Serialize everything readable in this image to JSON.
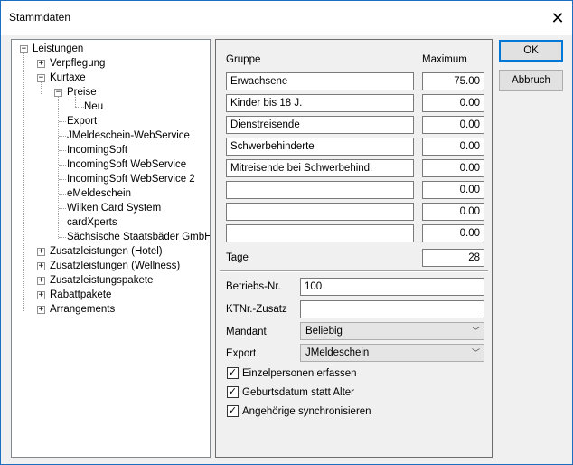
{
  "window": {
    "title": "Stammdaten",
    "close_glyph": "✕"
  },
  "tree": {
    "root": "Leistungen",
    "items": [
      "Verpflegung",
      "Kurtaxe",
      "Preise",
      "Neu",
      "Export",
      "JMeldeschein-WebService",
      "IncomingSoft",
      "IncomingSoft WebService",
      "IncomingSoft WebService 2",
      "eMeldeschein",
      "Wilken Card System",
      "cardXperts",
      "Sächsische Staatsbäder GmbH",
      "Zusatzleistungen (Hotel)",
      "Zusatzleistungen (Wellness)",
      "Zusatzleistungspakete",
      "Rabattpakete",
      "Arrangements"
    ],
    "plus": "+",
    "minus": "−"
  },
  "form": {
    "col_gruppe": "Gruppe",
    "col_maximum": "Maximum",
    "rows": [
      {
        "gruppe": "Erwachsene",
        "max": "75.00"
      },
      {
        "gruppe": "Kinder bis 18 J.",
        "max": "0.00"
      },
      {
        "gruppe": "Dienstreisende",
        "max": "0.00"
      },
      {
        "gruppe": "Schwerbehinderte",
        "max": "0.00"
      },
      {
        "gruppe": "Mitreisende bei Schwerbehind.",
        "max": "0.00"
      },
      {
        "gruppe": "",
        "max": "0.00"
      },
      {
        "gruppe": "",
        "max": "0.00"
      },
      {
        "gruppe": "",
        "max": "0.00"
      }
    ],
    "tage_label": "Tage",
    "tage_value": "28",
    "betriebs_label": "Betriebs-Nr.",
    "betriebs_value": "100",
    "ktnr_label": "KTNr.-Zusatz",
    "ktnr_value": "",
    "mandant_label": "Mandant",
    "mandant_value": "Beliebig",
    "export_label": "Export",
    "export_value": "JMeldeschein",
    "checkboxes": [
      {
        "label": "Einzelpersonen erfassen",
        "checked": true
      },
      {
        "label": "Geburtsdatum statt Alter",
        "checked": true
      },
      {
        "label": "Angehörige synchronisieren",
        "checked": true
      }
    ],
    "check_glyph": "✓",
    "combo_arrow": "﹀"
  },
  "buttons": {
    "ok": "OK",
    "cancel": "Abbruch"
  }
}
